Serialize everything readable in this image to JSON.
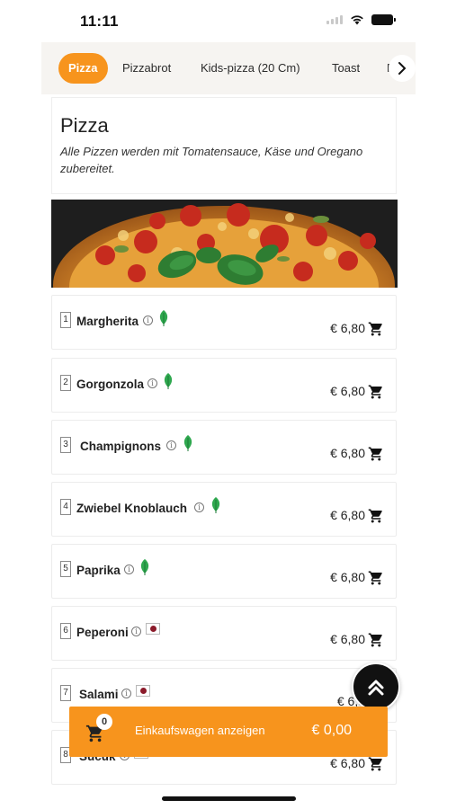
{
  "status_bar": {
    "time": "11:11"
  },
  "tabs": [
    {
      "label": "Pizza",
      "active": true
    },
    {
      "label": "Pizzabrot"
    },
    {
      "label": "Kids-pizza (20 Cm)"
    },
    {
      "label": "Toast"
    },
    {
      "label": "F"
    }
  ],
  "section": {
    "title": "Pizza",
    "description": "Alle Pizzen werden mit Tomatensauce, Käse und Oregano zubereitet."
  },
  "items": [
    {
      "number": "1",
      "name": "Margherita",
      "price": "€ 6,80",
      "tag": "leaf-icon"
    },
    {
      "number": "2",
      "name": "Gorgonzola",
      "price": "€ 6,80",
      "tag": "leaf-icon"
    },
    {
      "number": "3",
      "name": "Champignons",
      "price": "€ 6,80",
      "tag": "leaf-icon"
    },
    {
      "number": "4",
      "name": "Zwiebel Knoblauch",
      "price": "€ 6,80",
      "tag": "leaf-icon"
    },
    {
      "number": "5",
      "name": "Paprika",
      "price": "€ 6,80",
      "tag": "leaf-icon"
    },
    {
      "number": "6",
      "name": "Peperoni",
      "price": "€ 6,80",
      "tag": "meat-icon"
    },
    {
      "number": "7",
      "name": "Salami",
      "price": "€ 6,8",
      "tag": "meat-icon"
    },
    {
      "number": "8",
      "name": "Sucuk",
      "price": "€ 6,80",
      "tag": "meat-icon"
    }
  ],
  "cart": {
    "badge": "0",
    "label": "Einkaufswagen anzeigen",
    "total": "€ 0,00"
  },
  "colors": {
    "accent": "#f7941d",
    "leaf": "#2fa84f",
    "meat": "#8b1a2a"
  }
}
